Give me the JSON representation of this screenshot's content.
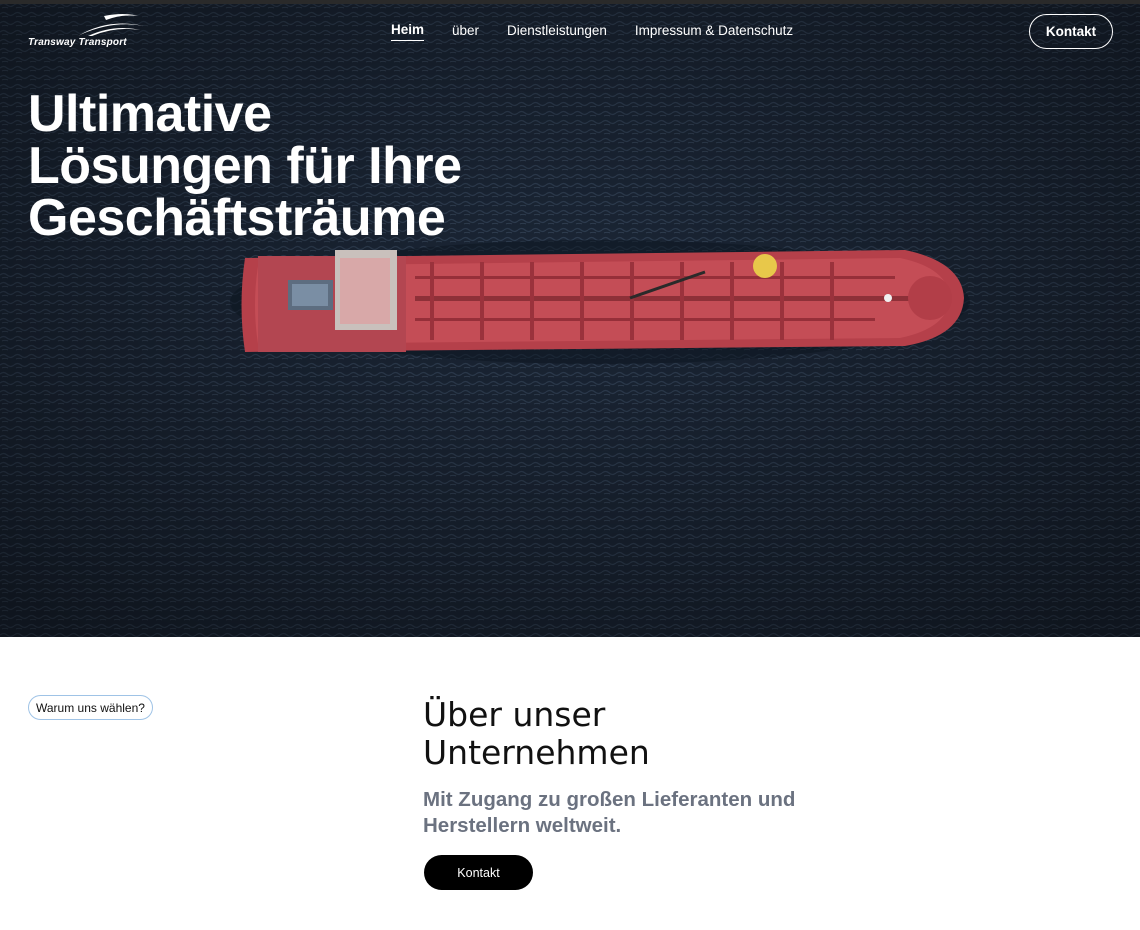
{
  "brand": {
    "logo_text": "Transway Transport"
  },
  "nav": {
    "items": [
      {
        "label": "Heim",
        "active": true
      },
      {
        "label": "über",
        "active": false
      },
      {
        "label": "Dienstleistungen",
        "active": false
      },
      {
        "label": "Impressum & Datenschutz",
        "active": false
      }
    ],
    "contact_label": "Kontakt"
  },
  "hero": {
    "title_line1": "Ultimative",
    "title_line2": "Lösungen für Ihre",
    "title_line3": "Geschäftsträume",
    "image_subject": "aerial view of a red tanker ship on dark ocean"
  },
  "about": {
    "badge": "Warum uns wählen?",
    "title_line1": "Über unser",
    "title_line2": "Unternehmen",
    "subtitle_line1": "Mit Zugang zu großen Lieferanten und",
    "subtitle_line2": "Herstellern weltweit.",
    "contact_label": "Kontakt"
  },
  "colors": {
    "ocean": "#1a2535",
    "ship_hull": "#b5404a",
    "ship_deck": "#c9525a",
    "subtitle_gray": "#6b7280",
    "badge_border": "#9fc3e6"
  }
}
